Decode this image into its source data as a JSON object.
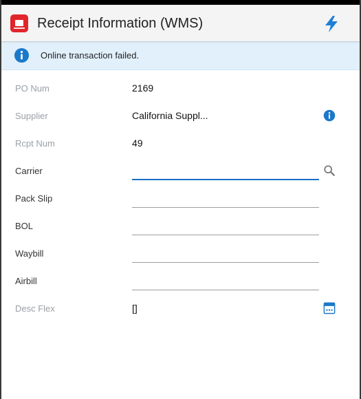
{
  "header": {
    "title": "Receipt Information (WMS)",
    "app_icon": "oracle-app-icon",
    "action_icon": "lightning-bolt-icon"
  },
  "banner": {
    "message": "Online transaction failed.",
    "icon": "info-icon"
  },
  "fields": {
    "po_num": {
      "label": "PO Num",
      "value": "2169"
    },
    "supplier": {
      "label": "Supplier",
      "value": "California Suppl..."
    },
    "rcpt_num": {
      "label": "Rcpt Num",
      "value": "49"
    },
    "carrier": {
      "label": "Carrier",
      "value": ""
    },
    "pack_slip": {
      "label": "Pack Slip",
      "value": ""
    },
    "bol": {
      "label": "BOL",
      "value": ""
    },
    "waybill": {
      "label": "Waybill",
      "value": ""
    },
    "airbill": {
      "label": "Airbill",
      "value": ""
    },
    "desc_flex": {
      "label": "Desc Flex",
      "value": "[]"
    }
  },
  "colors": {
    "accent": "#1a6fc4",
    "banner_bg": "#e1f0fb",
    "app_icon_bg": "#e0262b",
    "readonly_label": "#9aa0a6"
  }
}
